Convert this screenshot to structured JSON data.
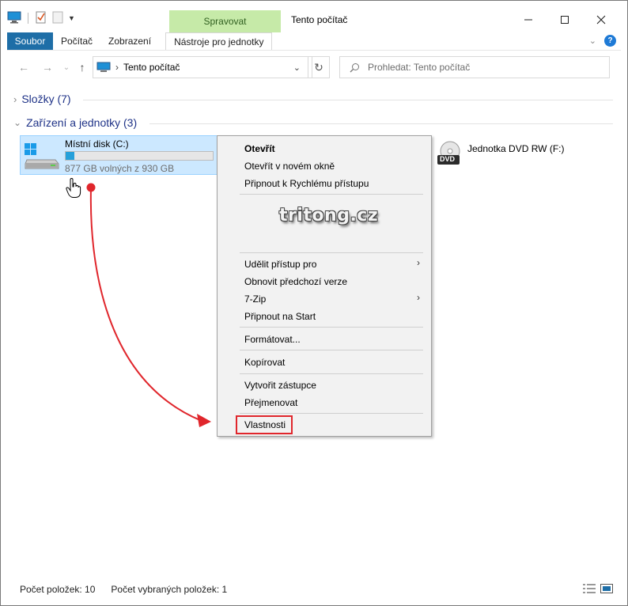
{
  "titlebar": {
    "context_tab_header": "Spravovat",
    "window_title": "Tento počítač"
  },
  "ribbon": {
    "tabs": [
      "Soubor",
      "Počítač",
      "Zobrazení"
    ],
    "context_tab": "Nástroje pro jednotky"
  },
  "address": {
    "path": "Tento počítač",
    "search_placeholder": "Prohledat: Tento počítač"
  },
  "groups": {
    "folders": "Složky (7)",
    "devices": "Zařízení a jednotky (3)"
  },
  "drives": {
    "c": {
      "name": "Místní disk (C:)",
      "free": "877 GB volných z 930 GB",
      "used_fraction": 0.057
    },
    "dvd": {
      "name": "Jednotka DVD RW (F:)",
      "badge": "DVD"
    }
  },
  "context_menu": {
    "open": "Otevřít",
    "open_new_window": "Otevřít v novém okně",
    "pin_quick_access": "Připnout k Rychlému přístupu",
    "watermark": "tritong.cz",
    "grant_access": "Udělit přístup pro",
    "restore_versions": "Obnovit předchozí verze",
    "seven_zip": "7-Zip",
    "pin_start": "Připnout na Start",
    "format": "Formátovat...",
    "copy": "Kopírovat",
    "create_shortcut": "Vytvořit zástupce",
    "rename": "Přejmenovat",
    "properties": "Vlastnosti"
  },
  "statusbar": {
    "item_count": "Počet položek: 10",
    "selected_count": "Počet vybraných položek: 1"
  },
  "colors": {
    "accent": "#1e6ea7",
    "selection": "#cce8ff",
    "context_tab": "#c6eaa8",
    "annotation_red": "#e0262c"
  }
}
